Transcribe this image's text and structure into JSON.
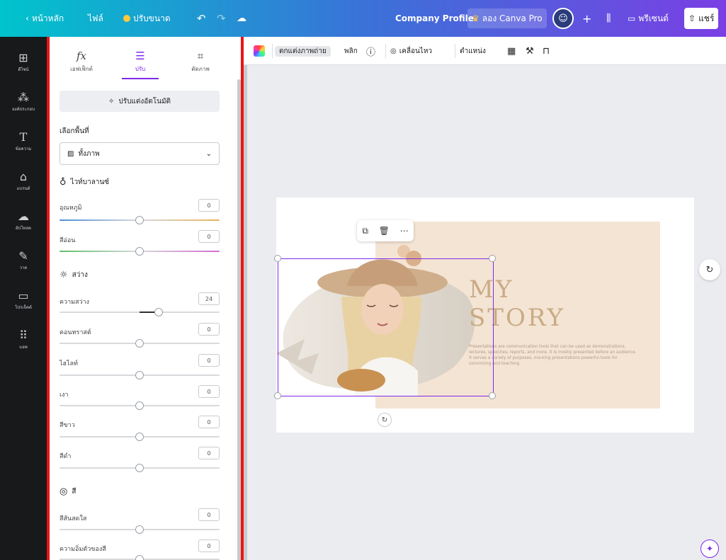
{
  "topbar": {
    "back_label": "หน้าหลัก",
    "file_label": "ไฟล์",
    "resize_label": "ปรับขนาด",
    "doc_title": "Company Profile",
    "pro_label": "ลอง Canva Pro",
    "present_label": "พรีเซนต์",
    "share_label": "แชร์"
  },
  "leftnav": {
    "items": [
      {
        "label": "ดีไซน์",
        "icon": "layout-icon"
      },
      {
        "label": "องค์ประกอบ",
        "icon": "elements-icon"
      },
      {
        "label": "ข้อความ",
        "icon": "text-icon"
      },
      {
        "label": "แบรนด์",
        "icon": "brand-icon"
      },
      {
        "label": "อัปโหลด",
        "icon": "upload-icon"
      },
      {
        "label": "วาด",
        "icon": "draw-icon"
      },
      {
        "label": "โปรเจ็คต์",
        "icon": "folder-icon"
      },
      {
        "label": "แอพ",
        "icon": "apps-icon"
      }
    ]
  },
  "panel": {
    "tabs": [
      {
        "label": "เอฟเฟ็กต์",
        "icon": "effects-icon"
      },
      {
        "label": "ปรับ",
        "icon": "adjust-icon"
      },
      {
        "label": "ตัดภาพ",
        "icon": "crop-icon"
      }
    ],
    "auto_enhance_label": "ปรับแต่งอัตโนมัติ",
    "select_area_label": "เลือกพื้นที่",
    "select_area_value": "ทั้งภาพ",
    "white_balance_title": "ไวท์บาลานซ์",
    "temperature": {
      "label": "อุณหภูมิ",
      "value": "0",
      "level": 0
    },
    "tint": {
      "label": "สีอ่อน",
      "value": "0",
      "level": 0
    },
    "light_title": "สว่าง",
    "brightness": {
      "label": "ความสว่าง",
      "value": "24",
      "level": 24
    },
    "contrast": {
      "label": "คอนทราสต์",
      "value": "0",
      "level": 0
    },
    "highlights": {
      "label": "ไฮไลท์",
      "value": "0",
      "level": 0
    },
    "shadows": {
      "label": "เงา",
      "value": "0",
      "level": 0
    },
    "whites": {
      "label": "สีขาว",
      "value": "0",
      "level": 0
    },
    "blacks": {
      "label": "สีดำ",
      "value": "0",
      "level": 0
    },
    "color_title": "สี",
    "vibrance": {
      "label": "สีสันสดใส",
      "value": "0",
      "level": 0
    },
    "saturation": {
      "label": "ความอิ่มตัวของสี",
      "value": "0",
      "level": 0
    }
  },
  "context_toolbar": {
    "edit_photo_label": "ตกแต่งภาพถ่าย",
    "flip_label": "พลิก",
    "animate_label": "เคลื่อนไหว",
    "position_label": "ตำแหน่ง"
  },
  "slide": {
    "title_line1": "MY",
    "title_line2": "STORY",
    "body": "Presentations are communication tools that can be used as demonstrations, lectures, speeches, reports, and more. It is mostly presented before an audience. It serves a variety of purposes, ma-king presentations powerful tools for convincing and teaching."
  },
  "colors": {
    "accent": "#7d2ae8",
    "highlight_border": "#e81515",
    "slide_bg": "#f4e4d4",
    "slide_title": "#c9ab84"
  }
}
